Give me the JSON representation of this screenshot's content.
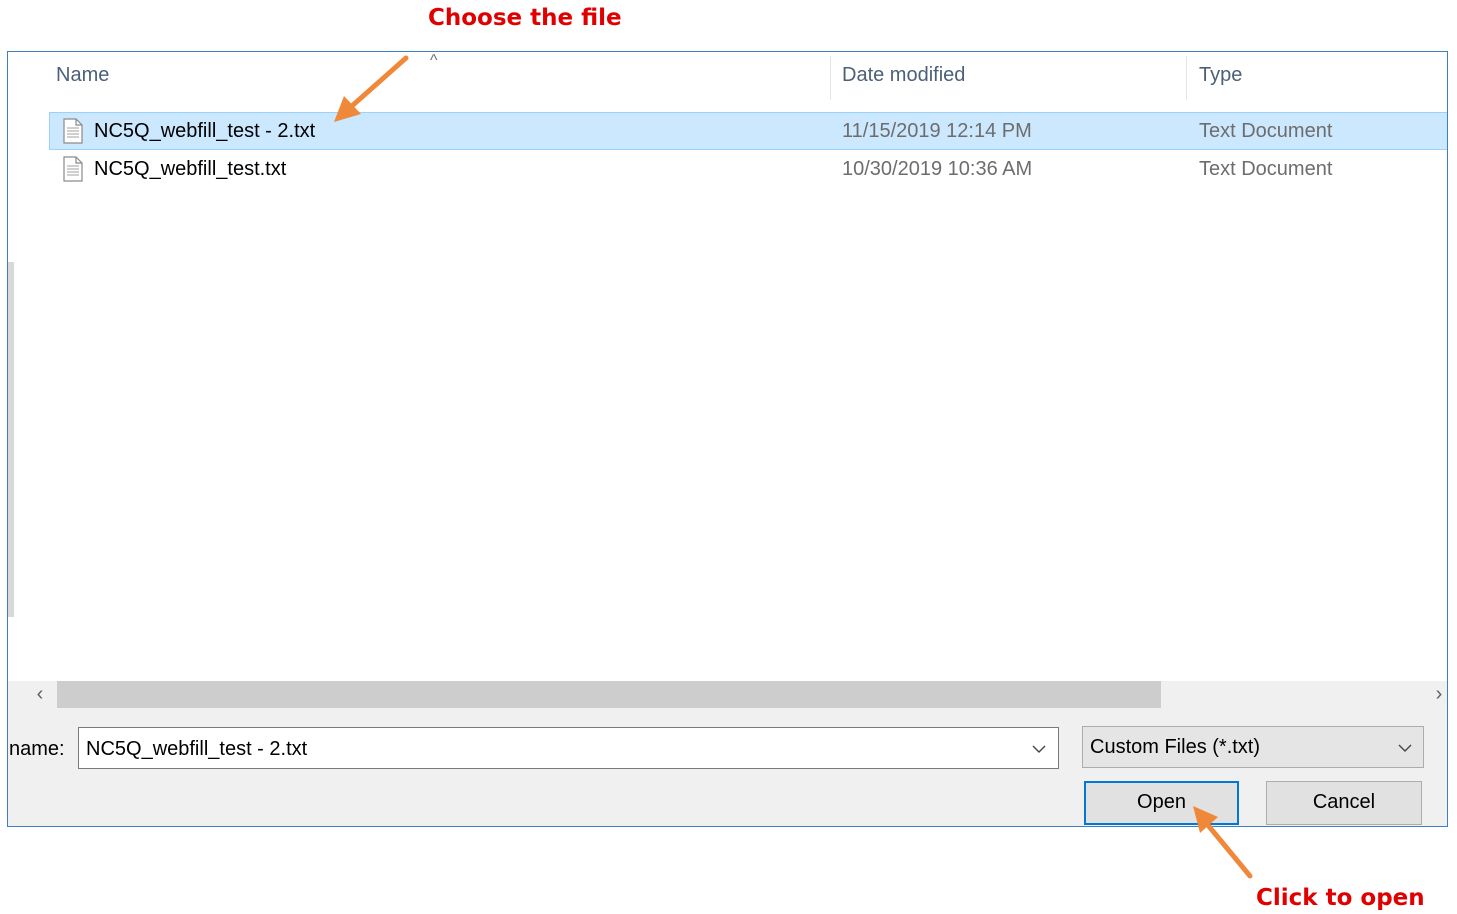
{
  "annotations": {
    "top": "Choose the file",
    "bottom": "Click to open"
  },
  "columns": {
    "name": "Name",
    "date": "Date modified",
    "type": "Type"
  },
  "files": [
    {
      "name": "NC5Q_webfill_test - 2.txt",
      "date": "11/15/2019 12:14 PM",
      "type": "Text Document",
      "selected": true
    },
    {
      "name": "NC5Q_webfill_test.txt",
      "date": "10/30/2019 10:36 AM",
      "type": "Text Document",
      "selected": false
    }
  ],
  "footer": {
    "filename_label": "name:",
    "filename_value": "NC5Q_webfill_test - 2.txt",
    "filetype_value": "Custom Files (*.txt)",
    "open_label": "Open",
    "cancel_label": "Cancel"
  },
  "icons": {
    "file": "text-file-icon",
    "sort": "sort-ascending-icon",
    "scroll_left": "chevron-left-icon",
    "scroll_right": "chevron-right-icon",
    "dropdown": "chevron-down-icon"
  },
  "colors": {
    "annotation": "#e00000",
    "arrow": "#f0883a",
    "selection": "#cce8ff",
    "accent": "#0078d7"
  }
}
